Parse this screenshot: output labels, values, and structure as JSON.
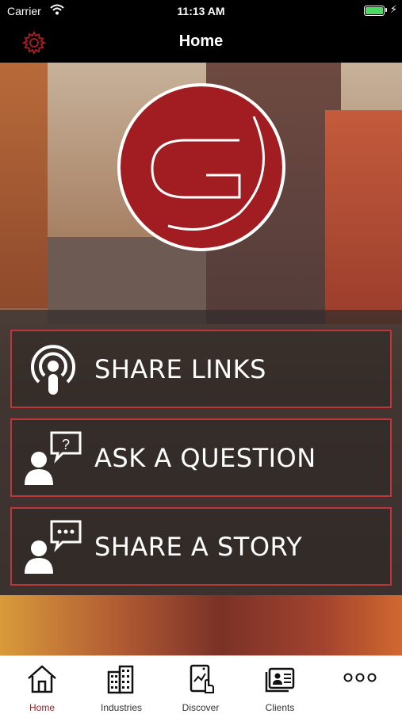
{
  "status_bar": {
    "carrier": "Carrier",
    "time": "11:13 AM"
  },
  "navbar": {
    "title": "Home"
  },
  "menu": [
    {
      "label": "SHARE LINKS",
      "icon": "podcast-icon"
    },
    {
      "label": "ASK A QUESTION",
      "icon": "ask-question-icon"
    },
    {
      "label": "SHARE A STORY",
      "icon": "share-story-icon"
    }
  ],
  "tabs": [
    {
      "label": "Home",
      "icon": "home-icon",
      "active": true
    },
    {
      "label": "Industries",
      "icon": "buildings-icon"
    },
    {
      "label": "Discover",
      "icon": "discover-icon"
    },
    {
      "label": "Clients",
      "icon": "clients-icon"
    },
    {
      "label": "",
      "icon": "more-icon"
    }
  ],
  "colors": {
    "accent": "#a11d22",
    "border": "#c0353a",
    "tab_active": "#a11d22"
  }
}
